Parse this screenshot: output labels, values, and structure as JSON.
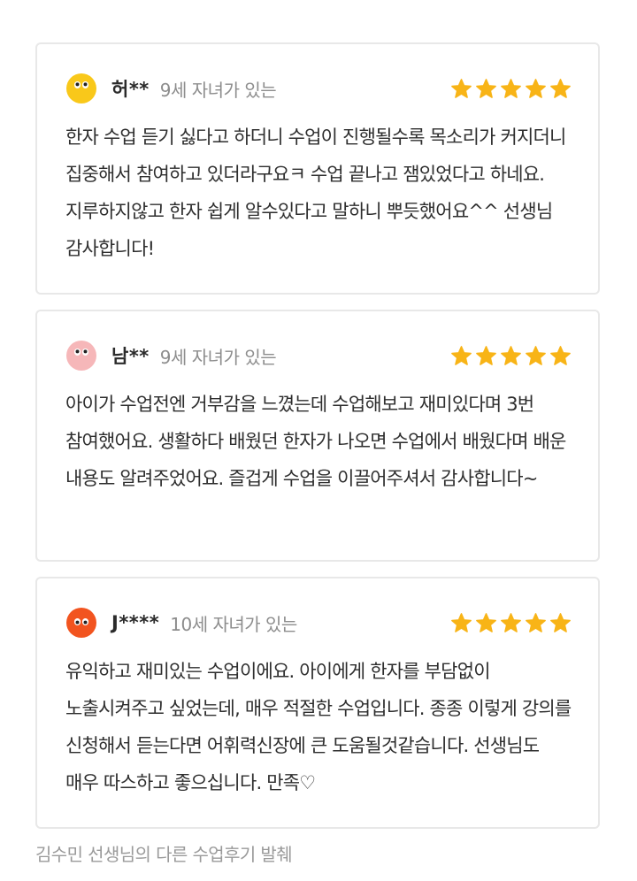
{
  "reviews": [
    {
      "name": "허**",
      "meta": "9세 자녀가 있는",
      "avatar_icon": "yellow-face-avatar",
      "avatar_color": "#f9c81a",
      "rating": 5,
      "text": "한자 수업 듣기 싫다고 하더니 수업이 진행될수록 목소리가 커지더니 집중해서 참여하고 있더라구요ㅋ 수업 끝나고 잼있었다고 하네요. 지루하지않고 한자 쉽게 알수있다고 말하니 뿌듯했어요^^ 선생님 감사합니다!"
    },
    {
      "name": "남**",
      "meta": "9세 자녀가 있는",
      "avatar_icon": "pink-face-avatar",
      "avatar_color": "#f6b7b9",
      "rating": 5,
      "text": "아이가 수업전엔 거부감을 느꼈는데 수업해보고 재미있다며 3번 참여했어요. 생활하다 배웠던 한자가 나오면 수업에서 배웠다며 배운 내용도 알려주었어요. 즐겁게 수업을 이끌어주셔서 감사합니다~"
    },
    {
      "name": "J****",
      "meta": "10세 자녀가 있는",
      "avatar_icon": "orange-face-avatar",
      "avatar_color": "#f2541f",
      "rating": 5,
      "text": "유익하고 재미있는 수업이에요. 아이에게 한자를 부담없이 노출시켜주고 싶었는데, 매우 적절한 수업입니다. 종종 이렇게 강의를 신청해서 듣는다면 어휘력신장에 큰 도움될것같습니다. 선생님도 매우 따스하고 좋으십니다. 만족♡"
    }
  ],
  "star_color": "#f8b417",
  "footer": {
    "more_reviews_label": "김수민 선생님의 다른 수업후기 발췌"
  }
}
